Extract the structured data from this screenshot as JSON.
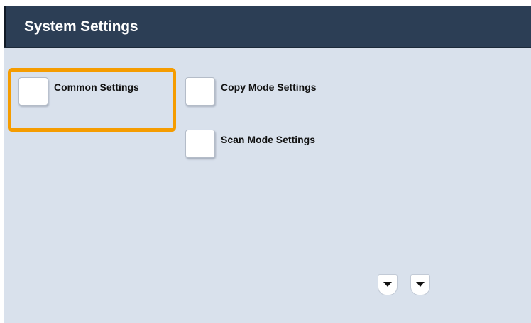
{
  "header": {
    "title": "System Settings"
  },
  "settings_items": [
    {
      "label": "Common Settings",
      "selected": true
    },
    {
      "label": "Copy Mode Settings",
      "selected": false
    },
    {
      "label": "Scan Mode Settings",
      "selected": false
    }
  ],
  "scroll_controls": {
    "page_down_icon": "arrow-down-icon",
    "scroll_down_icon": "arrow-down-icon"
  },
  "colors": {
    "title_bar": "#2c3e55",
    "background": "#d9e1ec",
    "selection_highlight": "#f59c00"
  }
}
